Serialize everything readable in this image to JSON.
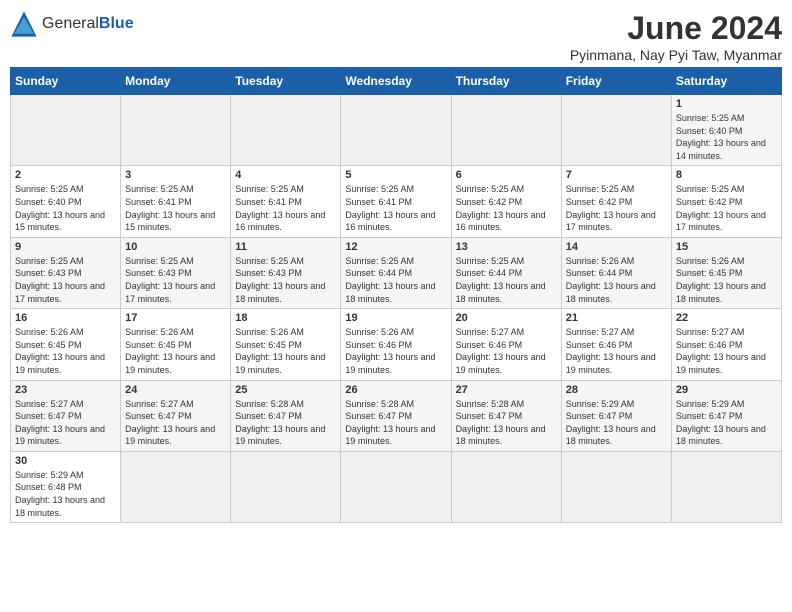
{
  "header": {
    "logo_text_general": "General",
    "logo_text_blue": "Blue",
    "month_title": "June 2024",
    "location": "Pyinmana, Nay Pyi Taw, Myanmar"
  },
  "days_of_week": [
    "Sunday",
    "Monday",
    "Tuesday",
    "Wednesday",
    "Thursday",
    "Friday",
    "Saturday"
  ],
  "weeks": [
    {
      "days": [
        {
          "num": "",
          "info": ""
        },
        {
          "num": "",
          "info": ""
        },
        {
          "num": "",
          "info": ""
        },
        {
          "num": "",
          "info": ""
        },
        {
          "num": "",
          "info": ""
        },
        {
          "num": "",
          "info": ""
        },
        {
          "num": "1",
          "info": "Sunrise: 5:25 AM\nSunset: 6:40 PM\nDaylight: 13 hours and 14 minutes."
        }
      ]
    },
    {
      "days": [
        {
          "num": "2",
          "info": "Sunrise: 5:25 AM\nSunset: 6:40 PM\nDaylight: 13 hours and 15 minutes."
        },
        {
          "num": "3",
          "info": "Sunrise: 5:25 AM\nSunset: 6:41 PM\nDaylight: 13 hours and 15 minutes."
        },
        {
          "num": "4",
          "info": "Sunrise: 5:25 AM\nSunset: 6:41 PM\nDaylight: 13 hours and 16 minutes."
        },
        {
          "num": "5",
          "info": "Sunrise: 5:25 AM\nSunset: 6:41 PM\nDaylight: 13 hours and 16 minutes."
        },
        {
          "num": "6",
          "info": "Sunrise: 5:25 AM\nSunset: 6:42 PM\nDaylight: 13 hours and 16 minutes."
        },
        {
          "num": "7",
          "info": "Sunrise: 5:25 AM\nSunset: 6:42 PM\nDaylight: 13 hours and 17 minutes."
        },
        {
          "num": "8",
          "info": "Sunrise: 5:25 AM\nSunset: 6:42 PM\nDaylight: 13 hours and 17 minutes."
        }
      ]
    },
    {
      "days": [
        {
          "num": "9",
          "info": "Sunrise: 5:25 AM\nSunset: 6:43 PM\nDaylight: 13 hours and 17 minutes."
        },
        {
          "num": "10",
          "info": "Sunrise: 5:25 AM\nSunset: 6:43 PM\nDaylight: 13 hours and 17 minutes."
        },
        {
          "num": "11",
          "info": "Sunrise: 5:25 AM\nSunset: 6:43 PM\nDaylight: 13 hours and 18 minutes."
        },
        {
          "num": "12",
          "info": "Sunrise: 5:25 AM\nSunset: 6:44 PM\nDaylight: 13 hours and 18 minutes."
        },
        {
          "num": "13",
          "info": "Sunrise: 5:25 AM\nSunset: 6:44 PM\nDaylight: 13 hours and 18 minutes."
        },
        {
          "num": "14",
          "info": "Sunrise: 5:26 AM\nSunset: 6:44 PM\nDaylight: 13 hours and 18 minutes."
        },
        {
          "num": "15",
          "info": "Sunrise: 5:26 AM\nSunset: 6:45 PM\nDaylight: 13 hours and 18 minutes."
        }
      ]
    },
    {
      "days": [
        {
          "num": "16",
          "info": "Sunrise: 5:26 AM\nSunset: 6:45 PM\nDaylight: 13 hours and 19 minutes."
        },
        {
          "num": "17",
          "info": "Sunrise: 5:26 AM\nSunset: 6:45 PM\nDaylight: 13 hours and 19 minutes."
        },
        {
          "num": "18",
          "info": "Sunrise: 5:26 AM\nSunset: 6:45 PM\nDaylight: 13 hours and 19 minutes."
        },
        {
          "num": "19",
          "info": "Sunrise: 5:26 AM\nSunset: 6:46 PM\nDaylight: 13 hours and 19 minutes."
        },
        {
          "num": "20",
          "info": "Sunrise: 5:27 AM\nSunset: 6:46 PM\nDaylight: 13 hours and 19 minutes."
        },
        {
          "num": "21",
          "info": "Sunrise: 5:27 AM\nSunset: 6:46 PM\nDaylight: 13 hours and 19 minutes."
        },
        {
          "num": "22",
          "info": "Sunrise: 5:27 AM\nSunset: 6:46 PM\nDaylight: 13 hours and 19 minutes."
        }
      ]
    },
    {
      "days": [
        {
          "num": "23",
          "info": "Sunrise: 5:27 AM\nSunset: 6:47 PM\nDaylight: 13 hours and 19 minutes."
        },
        {
          "num": "24",
          "info": "Sunrise: 5:27 AM\nSunset: 6:47 PM\nDaylight: 13 hours and 19 minutes."
        },
        {
          "num": "25",
          "info": "Sunrise: 5:28 AM\nSunset: 6:47 PM\nDaylight: 13 hours and 19 minutes."
        },
        {
          "num": "26",
          "info": "Sunrise: 5:28 AM\nSunset: 6:47 PM\nDaylight: 13 hours and 19 minutes."
        },
        {
          "num": "27",
          "info": "Sunrise: 5:28 AM\nSunset: 6:47 PM\nDaylight: 13 hours and 18 minutes."
        },
        {
          "num": "28",
          "info": "Sunrise: 5:29 AM\nSunset: 6:47 PM\nDaylight: 13 hours and 18 minutes."
        },
        {
          "num": "29",
          "info": "Sunrise: 5:29 AM\nSunset: 6:47 PM\nDaylight: 13 hours and 18 minutes."
        }
      ]
    },
    {
      "days": [
        {
          "num": "30",
          "info": "Sunrise: 5:29 AM\nSunset: 6:48 PM\nDaylight: 13 hours and 18 minutes."
        },
        {
          "num": "",
          "info": ""
        },
        {
          "num": "",
          "info": ""
        },
        {
          "num": "",
          "info": ""
        },
        {
          "num": "",
          "info": ""
        },
        {
          "num": "",
          "info": ""
        },
        {
          "num": "",
          "info": ""
        }
      ]
    }
  ]
}
